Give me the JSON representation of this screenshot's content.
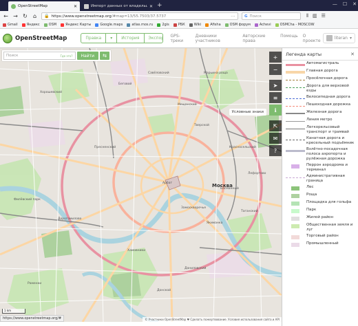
{
  "browser": {
    "tabs": [
      {
        "title": "OpenStreetMap",
        "active": true
      },
      {
        "title": "Импорт данных от владельцев ка...",
        "active": false
      }
    ],
    "url_main": "https://www.openstreetmap.org",
    "url_rest": "/#map=13/55.7503/37.5737",
    "search_placeholder": "Поиск",
    "bookmarks": [
      "Gmail",
      "Яндекс",
      "OSM",
      "Яндекс Карты",
      "Google.maps",
      "atlas.mos.ru",
      "2gis",
      "РБК",
      "Wiki",
      "Afisha",
      "OSM форум",
      "Achevi",
      "OSMCha - MOSCOW"
    ]
  },
  "osm": {
    "logo_text": "OpenStreetMap",
    "edit_buttons": [
      "Правка",
      "▾",
      "История",
      "Экспорт"
    ],
    "nav_links": [
      "GPS-треки",
      "Дневники участников",
      "Авторские права",
      "Помощь",
      "О проекте"
    ],
    "user_name": "literan"
  },
  "search": {
    "placeholder": "Поиск",
    "what_is_here": "Где это?",
    "go_label": "Найти",
    "directions_icon": "⇆"
  },
  "map": {
    "labels": [
      "Хорошевский",
      "Беговой",
      "Савёловский",
      "Марьина роща",
      "Пресненский",
      "Тверской",
      "Красносельский",
      "Басманный",
      "Арбат",
      "Москва",
      "Хамовники",
      "Якиманка",
      "Дорогомилово",
      "Филёвский парк",
      "Раменки",
      "Донской",
      "Таганский",
      "Замоскворечье",
      "Даниловский",
      "Лефортово",
      "Мещанский"
    ],
    "notes_tip": "Условные знаки",
    "scale_label": "1 km",
    "attribution": "© Участники OpenStreetMap ♥ Сделать пожертвование. Условия использования сайта и API",
    "status_url": "https://www.openstreetmap.org/#"
  },
  "controls": [
    {
      "icon": "+",
      "name": "zoom-in"
    },
    {
      "icon": "−",
      "name": "zoom-out"
    },
    {
      "icon": "➤",
      "name": "locate"
    },
    {
      "icon": "≡",
      "name": "layers"
    },
    {
      "icon": "ℹ",
      "name": "legend"
    },
    {
      "icon": "⇱",
      "name": "share"
    },
    {
      "icon": "✉",
      "name": "note"
    },
    {
      "icon": "?",
      "name": "query"
    }
  ],
  "legend": {
    "title": "Легенда карты",
    "items": [
      {
        "label": "Автомагистраль",
        "color": "#e990a0",
        "kind": "line",
        "w": 3
      },
      {
        "label": "Главная дорога",
        "color": "#f8d6a8",
        "kind": "line",
        "w": 4
      },
      {
        "label": "Просёлочная дорога",
        "color": "#a37f3d",
        "kind": "dash",
        "w": 1
      },
      {
        "label": "Дорога для верховой езды",
        "color": "#4aa05a",
        "kind": "dash",
        "w": 1
      },
      {
        "label": "Велосипедная дорога",
        "color": "#4a6cd4",
        "kind": "dash",
        "w": 1
      },
      {
        "label": "Пешеходная дорожка",
        "color": "#f58a7a",
        "kind": "dash",
        "w": 1
      },
      {
        "label": "Железная дорога",
        "color": "#888888",
        "kind": "line",
        "w": 2
      },
      {
        "label": "Линия метро",
        "color": "#999999",
        "kind": "line",
        "w": 1
      },
      {
        "label": "Легкорельсовый транспорт и трамвай",
        "color": "#777777",
        "kind": "line",
        "w": 1
      },
      {
        "label": "Канатная дорога и кресельный подъёмник",
        "color": "#666666",
        "kind": "dash",
        "w": 1
      },
      {
        "label": "Взлётно-посадочная полоса аэропорта и рулёжная дорожка",
        "color": "#bbbbcc",
        "kind": "line",
        "w": 3
      },
      {
        "label": "Перрон аэродрома и терминал",
        "color": "#d8b0e8",
        "kind": "box",
        "w": 0
      },
      {
        "label": "Административная граница",
        "color": "#c9a8d4",
        "kind": "dash",
        "w": 1
      },
      {
        "label": "Лес",
        "color": "#8cc47a",
        "kind": "box",
        "w": 0
      },
      {
        "label": "Роща",
        "color": "#aed1a0",
        "kind": "box",
        "w": 0
      },
      {
        "label": "Площадка для гольфа",
        "color": "#b5e3b5",
        "kind": "box",
        "w": 0
      },
      {
        "label": "Парк",
        "color": "#c8facc",
        "kind": "box",
        "w": 0
      },
      {
        "label": "Жилой район",
        "color": "#e0dfdf",
        "kind": "box",
        "w": 0
      },
      {
        "label": "Общественная земля и луг",
        "color": "#cdebb0",
        "kind": "box",
        "w": 0
      },
      {
        "label": "Торговый район",
        "color": "#f2dad9",
        "kind": "box",
        "w": 0
      },
      {
        "label": "Промышленный",
        "color": "#ebdbe8",
        "kind": "box",
        "w": 0
      }
    ]
  }
}
